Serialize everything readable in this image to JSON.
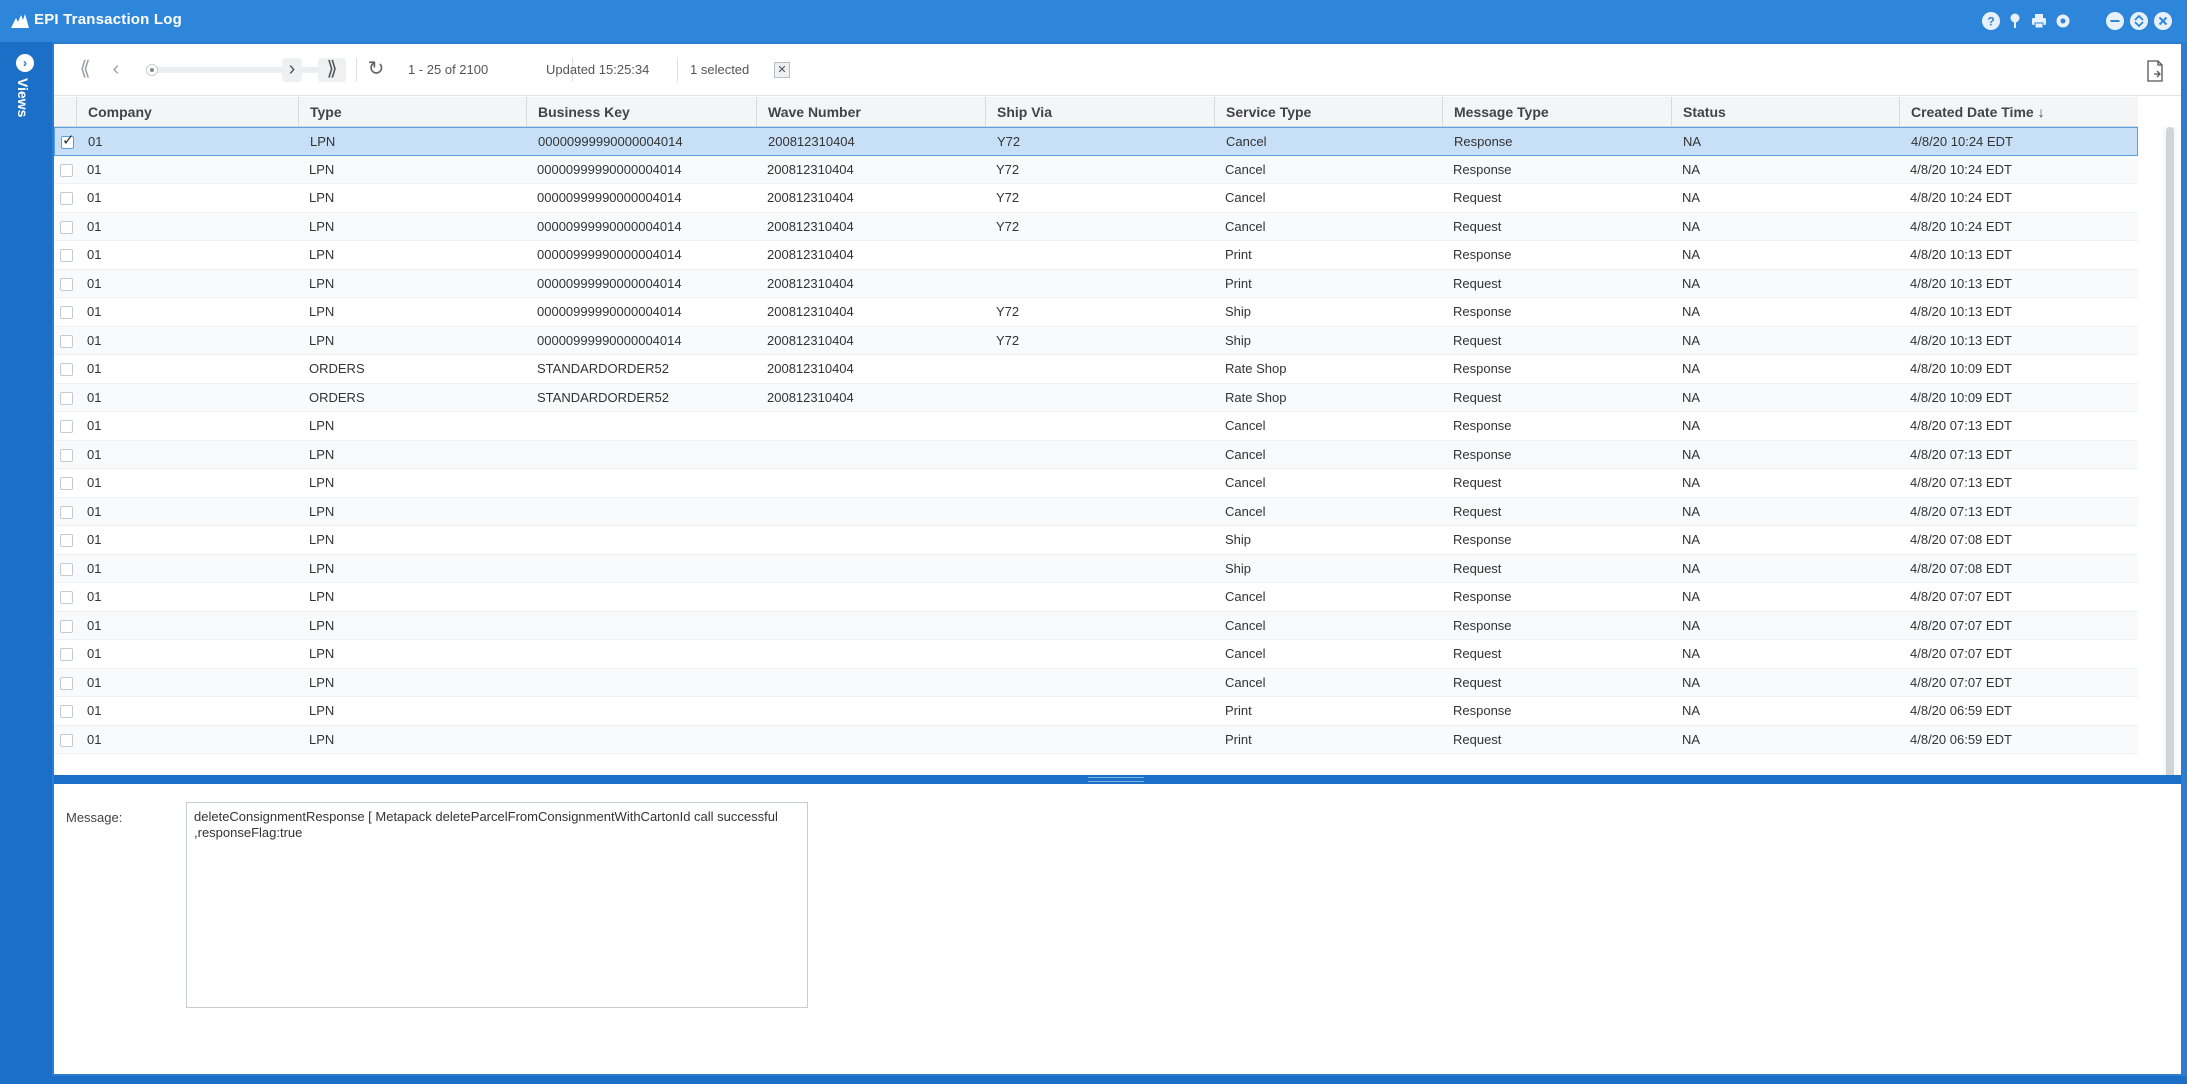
{
  "window": {
    "title": "EPI Transaction Log",
    "accent": "#2d86d9",
    "controls": [
      "help-icon",
      "pin-icon",
      "print-icon",
      "settings-icon",
      "minimize-icon",
      "maximize-icon",
      "close-icon"
    ]
  },
  "sidebar": {
    "views_label": "Views"
  },
  "toolbar": {
    "pager_text": "1 - 25 of 2100",
    "updated_text": "Updated 15:25:34",
    "selected_text": "1 selected",
    "clear_selection_glyph": "✕",
    "first_glyph": "⟪",
    "prev_glyph": "‹",
    "next_glyph": "›",
    "last_glyph": "⟫",
    "refresh_glyph": "↻"
  },
  "grid": {
    "columns": [
      "Company",
      "Type",
      "Business Key",
      "Wave Number",
      "Ship Via",
      "Service Type",
      "Message Type",
      "Status",
      "Created Date Time ↓"
    ],
    "rows": [
      [
        "01",
        "LPN",
        "00000999990000004014",
        "200812310404",
        "Y72",
        "Cancel",
        "Response",
        "NA",
        "4/8/20 10:24 EDT"
      ],
      [
        "01",
        "LPN",
        "00000999990000004014",
        "200812310404",
        "Y72",
        "Cancel",
        "Response",
        "NA",
        "4/8/20 10:24 EDT"
      ],
      [
        "01",
        "LPN",
        "00000999990000004014",
        "200812310404",
        "Y72",
        "Cancel",
        "Request",
        "NA",
        "4/8/20 10:24 EDT"
      ],
      [
        "01",
        "LPN",
        "00000999990000004014",
        "200812310404",
        "Y72",
        "Cancel",
        "Request",
        "NA",
        "4/8/20 10:24 EDT"
      ],
      [
        "01",
        "LPN",
        "00000999990000004014",
        "200812310404",
        "",
        "Print",
        "Response",
        "NA",
        "4/8/20 10:13 EDT"
      ],
      [
        "01",
        "LPN",
        "00000999990000004014",
        "200812310404",
        "",
        "Print",
        "Request",
        "NA",
        "4/8/20 10:13 EDT"
      ],
      [
        "01",
        "LPN",
        "00000999990000004014",
        "200812310404",
        "Y72",
        "Ship",
        "Response",
        "NA",
        "4/8/20 10:13 EDT"
      ],
      [
        "01",
        "LPN",
        "00000999990000004014",
        "200812310404",
        "Y72",
        "Ship",
        "Request",
        "NA",
        "4/8/20 10:13 EDT"
      ],
      [
        "01",
        "ORDERS",
        "STANDARDORDER52",
        "200812310404",
        "",
        "Rate Shop",
        "Response",
        "NA",
        "4/8/20 10:09 EDT"
      ],
      [
        "01",
        "ORDERS",
        "STANDARDORDER52",
        "200812310404",
        "",
        "Rate Shop",
        "Request",
        "NA",
        "4/8/20 10:09 EDT"
      ],
      [
        "01",
        "LPN",
        "",
        "",
        "",
        "Cancel",
        "Response",
        "NA",
        "4/8/20 07:13 EDT"
      ],
      [
        "01",
        "LPN",
        "",
        "",
        "",
        "Cancel",
        "Response",
        "NA",
        "4/8/20 07:13 EDT"
      ],
      [
        "01",
        "LPN",
        "",
        "",
        "",
        "Cancel",
        "Request",
        "NA",
        "4/8/20 07:13 EDT"
      ],
      [
        "01",
        "LPN",
        "",
        "",
        "",
        "Cancel",
        "Request",
        "NA",
        "4/8/20 07:13 EDT"
      ],
      [
        "01",
        "LPN",
        "",
        "",
        "",
        "Ship",
        "Response",
        "NA",
        "4/8/20 07:08 EDT"
      ],
      [
        "01",
        "LPN",
        "",
        "",
        "",
        "Ship",
        "Request",
        "NA",
        "4/8/20 07:08 EDT"
      ],
      [
        "01",
        "LPN",
        "",
        "",
        "",
        "Cancel",
        "Response",
        "NA",
        "4/8/20 07:07 EDT"
      ],
      [
        "01",
        "LPN",
        "",
        "",
        "",
        "Cancel",
        "Response",
        "NA",
        "4/8/20 07:07 EDT"
      ],
      [
        "01",
        "LPN",
        "",
        "",
        "",
        "Cancel",
        "Request",
        "NA",
        "4/8/20 07:07 EDT"
      ],
      [
        "01",
        "LPN",
        "",
        "",
        "",
        "Cancel",
        "Request",
        "NA",
        "4/8/20 07:07 EDT"
      ],
      [
        "01",
        "LPN",
        "",
        "",
        "",
        "Print",
        "Response",
        "NA",
        "4/8/20 06:59 EDT"
      ],
      [
        "01",
        "LPN",
        "",
        "",
        "",
        "Print",
        "Request",
        "NA",
        "4/8/20 06:59 EDT"
      ]
    ],
    "selected_row": 0
  },
  "detail": {
    "message_label": "Message:",
    "message_value": "deleteConsignmentResponse [ Metapack deleteParcelFromConsignmentWithCartonId call successful ,responseFlag:true"
  }
}
